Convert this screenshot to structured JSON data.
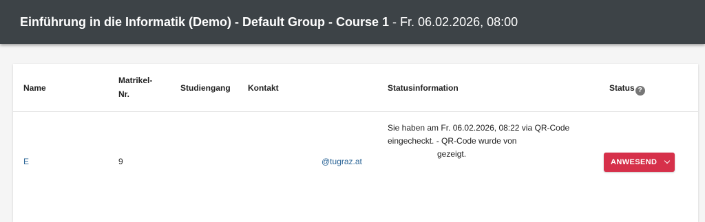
{
  "header": {
    "title_bold": "Einführung in die Informatik (Demo) - Default Group - Course 1",
    "title_rest": " - Fr. 06.02.2026, 08:00"
  },
  "table": {
    "columns": {
      "name": "Name",
      "matrikel_line1": "Matrikel-",
      "matrikel_line2": "Nr.",
      "studiengang": "Studiengang",
      "kontakt": "Kontakt",
      "statusinfo": "Statusinformation",
      "status": "Status"
    },
    "row": {
      "name": "E",
      "matrikel": "9",
      "studiengang": "",
      "kontakt": "@tugraz.at",
      "statusinfo_line1": "Sie haben am Fr. 06.02.2026, 08:22 via QR-Code",
      "statusinfo_line2": "eingecheckt. - QR-Code wurde von",
      "statusinfo_line3": "gezeigt.",
      "status_label": "ANWESEND"
    },
    "help_icon_glyph": "?"
  },
  "colors": {
    "header_bg": "#3d4347",
    "status_button": "#d6304a",
    "link": "#2a6496"
  }
}
